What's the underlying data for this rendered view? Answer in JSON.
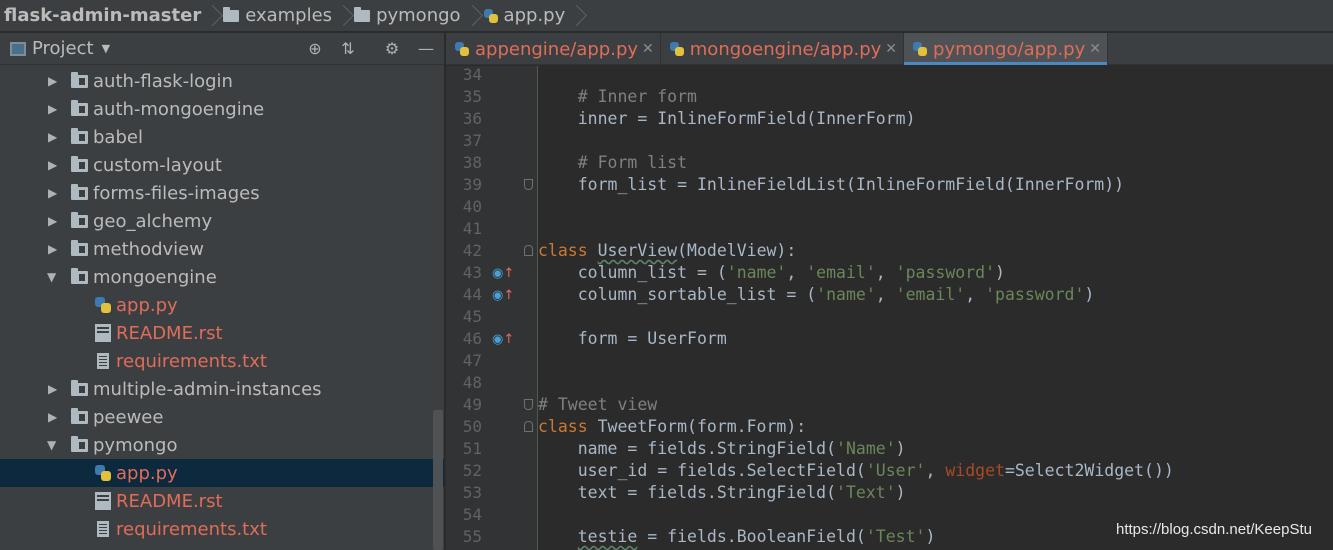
{
  "breadcrumb": {
    "root": "flask-admin-master",
    "items": [
      "examples",
      "pymongo",
      "app.py"
    ]
  },
  "project_panel": {
    "title": "Project",
    "tree": [
      {
        "label": "auth-flask-login",
        "type": "folder",
        "expanded": false
      },
      {
        "label": "auth-mongoengine",
        "type": "folder",
        "expanded": false
      },
      {
        "label": "babel",
        "type": "folder",
        "expanded": false
      },
      {
        "label": "custom-layout",
        "type": "folder",
        "expanded": false
      },
      {
        "label": "forms-files-images",
        "type": "folder",
        "expanded": false
      },
      {
        "label": "geo_alchemy",
        "type": "folder",
        "expanded": false
      },
      {
        "label": "methodview",
        "type": "folder",
        "expanded": false
      },
      {
        "label": "mongoengine",
        "type": "folder",
        "expanded": true
      },
      {
        "label": "app.py",
        "type": "python"
      },
      {
        "label": "README.rst",
        "type": "rst"
      },
      {
        "label": "requirements.txt",
        "type": "text"
      },
      {
        "label": "multiple-admin-instances",
        "type": "folder",
        "expanded": false
      },
      {
        "label": "peewee",
        "type": "folder",
        "expanded": false
      },
      {
        "label": "pymongo",
        "type": "folder",
        "expanded": true
      },
      {
        "label": "app.py",
        "type": "python",
        "selected": true
      },
      {
        "label": "README.rst",
        "type": "rst"
      },
      {
        "label": "requirements.txt",
        "type": "text"
      }
    ]
  },
  "tabs": [
    {
      "label": "appengine/app.py",
      "active": false
    },
    {
      "label": "mongoengine/app.py",
      "active": false
    },
    {
      "label": "pymongo/app.py",
      "active": true
    }
  ],
  "editor": {
    "lines": [
      "34",
      "35",
      "36",
      "37",
      "38",
      "39",
      "40",
      "41",
      "42",
      "43",
      "44",
      "45",
      "46",
      "47",
      "48",
      "49",
      "50",
      "51",
      "52",
      "53",
      "54",
      "55"
    ],
    "code": {
      "l35": "# Inner form",
      "l36": "inner = InlineFormField(InnerForm)",
      "l38": "# Form list",
      "l39": "form_list = InlineFieldList(InlineFormField(InnerForm))",
      "l42_kw": "class",
      "l42_name": "UserView",
      "l42_rest": "(ModelView):",
      "l43_pre": "column_list = (",
      "l43_s1": "'name'",
      "l43_s2": "'email'",
      "l43_s3": "'password'",
      "l44_pre": "column_sortable_list = (",
      "l44_s1": "'name'",
      "l44_s2": "'email'",
      "l44_s3": "'password'",
      "l46": "form = UserForm",
      "l49": "# Tweet view",
      "l50_kw": "class",
      "l50_name": "TweetForm",
      "l50_rest": "(form.Form):",
      "l51_pre": "name = fields.StringField(",
      "l51_s": "'Name'",
      "l52_pre": "user_id = fields.SelectField(",
      "l52_s": "'User'",
      "l52_pm": "widget",
      "l52_rest": "=Select2Widget())",
      "l53_pre": "text = fields.StringField(",
      "l53_s": "'Text'",
      "l55_var": "testie",
      "l55_pre": " = fields.BooleanField(",
      "l55_s": "'Test'"
    }
  },
  "watermark": "https://blog.csdn.net/KeepStu"
}
